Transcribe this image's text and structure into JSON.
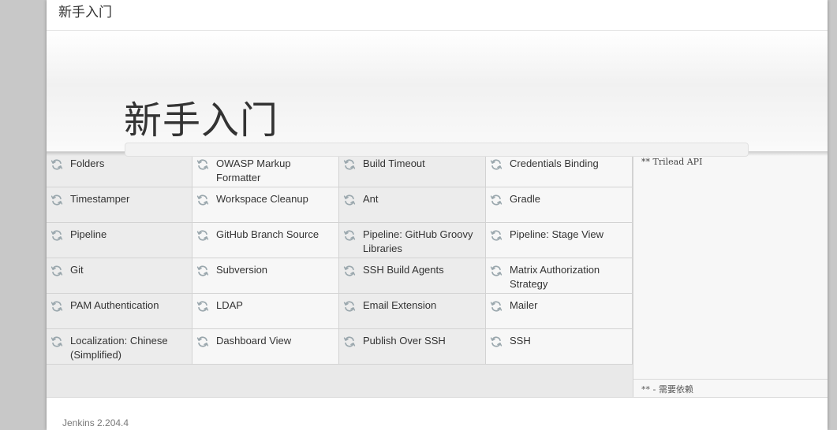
{
  "dialog": {
    "title": "新手入门"
  },
  "hero": {
    "title": "新手入门",
    "progress": 0
  },
  "plugins": [
    {
      "label": "Folders",
      "icon": "refresh-icon"
    },
    {
      "label": "OWASP Markup Formatter",
      "icon": "refresh-icon"
    },
    {
      "label": "Build Timeout",
      "icon": "refresh-icon"
    },
    {
      "label": "Credentials Binding",
      "icon": "refresh-icon"
    },
    {
      "label": "Timestamper",
      "icon": "refresh-icon"
    },
    {
      "label": "Workspace Cleanup",
      "icon": "refresh-icon"
    },
    {
      "label": "Ant",
      "icon": "refresh-icon"
    },
    {
      "label": "Gradle",
      "icon": "refresh-icon"
    },
    {
      "label": "Pipeline",
      "icon": "refresh-icon"
    },
    {
      "label": "GitHub Branch Source",
      "icon": "refresh-icon"
    },
    {
      "label": "Pipeline: GitHub Groovy Libraries",
      "icon": "refresh-icon"
    },
    {
      "label": "Pipeline: Stage View",
      "icon": "refresh-icon"
    },
    {
      "label": "Git",
      "icon": "refresh-icon"
    },
    {
      "label": "Subversion",
      "icon": "refresh-icon"
    },
    {
      "label": "SSH Build Agents",
      "icon": "refresh-icon"
    },
    {
      "label": "Matrix Authorization Strategy",
      "icon": "refresh-icon"
    },
    {
      "label": "PAM Authentication",
      "icon": "refresh-icon"
    },
    {
      "label": "LDAP",
      "icon": "refresh-icon"
    },
    {
      "label": "Email Extension",
      "icon": "refresh-icon"
    },
    {
      "label": "Mailer",
      "icon": "refresh-icon"
    },
    {
      "label": "Localization: Chinese (Simplified)",
      "icon": "refresh-icon"
    },
    {
      "label": "Dashboard View",
      "icon": "refresh-icon"
    },
    {
      "label": "Publish Over SSH",
      "icon": "refresh-icon"
    },
    {
      "label": "SSH",
      "icon": "refresh-icon"
    }
  ],
  "log": {
    "text": "** Trilead API",
    "legend": "** - 需要依赖"
  },
  "footer": {
    "version": "Jenkins 2.204.4"
  },
  "colors": {
    "icon": "#9aa7ad",
    "progress": "#7ab35c"
  }
}
